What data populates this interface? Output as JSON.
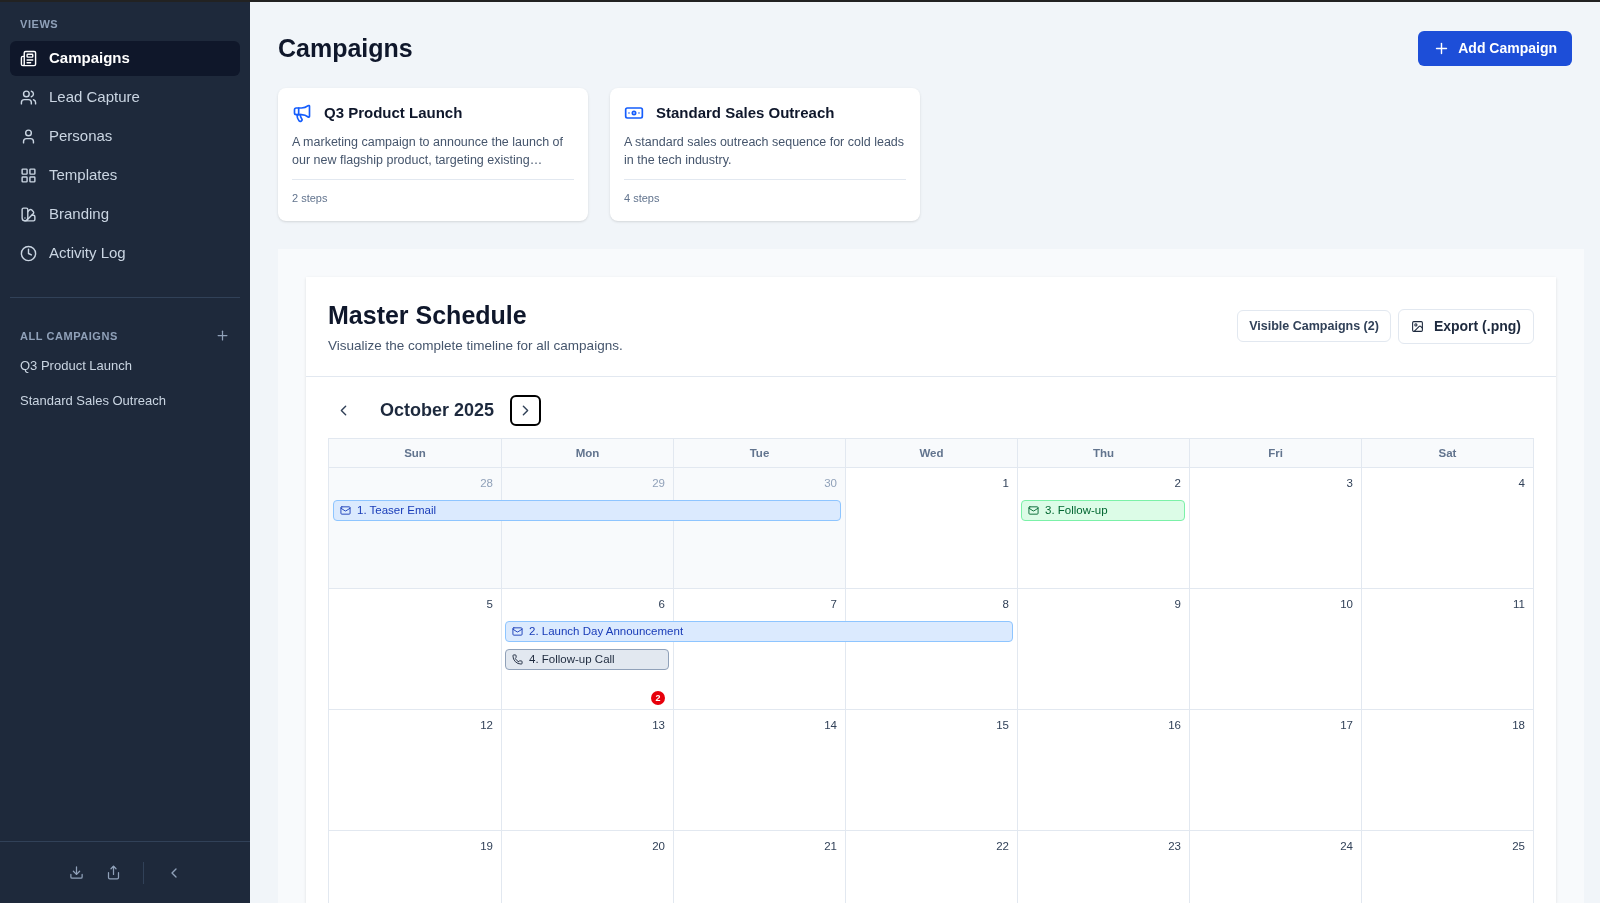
{
  "sidebar": {
    "views_heading": "VIEWS",
    "items": [
      {
        "label": "Campaigns",
        "selected": true
      },
      {
        "label": "Lead Capture",
        "selected": false
      },
      {
        "label": "Personas",
        "selected": false
      },
      {
        "label": "Templates",
        "selected": false
      },
      {
        "label": "Branding",
        "selected": false
      },
      {
        "label": "Activity Log",
        "selected": false
      }
    ],
    "campaigns_heading": "ALL CAMPAIGNS",
    "campaigns": [
      "Q3 Product Launch",
      "Standard Sales Outreach"
    ]
  },
  "header": {
    "title": "Campaigns",
    "add_button": "Add Campaign"
  },
  "cards": [
    {
      "title": "Q3 Product Launch",
      "description": "A marketing campaign to announce the launch of our new flagship product, targeting existing…",
      "steps": "2 steps"
    },
    {
      "title": "Standard Sales Outreach",
      "description": "A standard sales outreach sequence for cold leads in the tech industry.",
      "steps": "4 steps"
    }
  ],
  "schedule": {
    "title": "Master Schedule",
    "subtitle": "Visualize the complete timeline for all campaigns.",
    "visible_button": "Visible Campaigns (2)",
    "export_button": "Export (.png)",
    "month": "October 2025",
    "weekdays": [
      "Sun",
      "Mon",
      "Tue",
      "Wed",
      "Thu",
      "Fri",
      "Sat"
    ],
    "weeks": [
      {
        "days": [
          {
            "number": "28",
            "muted": true
          },
          {
            "number": "29",
            "muted": true
          },
          {
            "number": "30",
            "muted": true
          },
          {
            "number": "1",
            "muted": false
          },
          {
            "number": "2",
            "muted": false
          },
          {
            "number": "3",
            "muted": false
          },
          {
            "number": "4",
            "muted": false
          }
        ],
        "events": [
          {
            "label": "1. Teaser Email",
            "kind": "email",
            "color": "#dbeafe"
          },
          {
            "label": "3. Follow-up",
            "kind": "email",
            "color": "#dcfce7"
          }
        ]
      },
      {
        "days": [
          {
            "number": "5",
            "muted": false
          },
          {
            "number": "6",
            "muted": false,
            "badge": "2"
          },
          {
            "number": "7",
            "muted": false
          },
          {
            "number": "8",
            "muted": false
          },
          {
            "number": "9",
            "muted": false
          },
          {
            "number": "10",
            "muted": false
          },
          {
            "number": "11",
            "muted": false
          }
        ],
        "events": [
          {
            "label": "2. Launch Day Announcement",
            "kind": "email",
            "color": "#dbeafe"
          },
          {
            "label": "4. Follow-up Call",
            "kind": "call",
            "color": "#e2e8f0"
          }
        ]
      },
      {
        "days": [
          {
            "number": "12",
            "muted": false
          },
          {
            "number": "13",
            "muted": false
          },
          {
            "number": "14",
            "muted": false
          },
          {
            "number": "15",
            "muted": false
          },
          {
            "number": "16",
            "muted": false
          },
          {
            "number": "17",
            "muted": false
          },
          {
            "number": "18",
            "muted": false
          }
        ]
      },
      {
        "days": [
          {
            "number": "19",
            "muted": false
          },
          {
            "number": "20",
            "muted": false
          },
          {
            "number": "21",
            "muted": false
          },
          {
            "number": "22",
            "muted": false
          },
          {
            "number": "23",
            "muted": false
          },
          {
            "number": "24",
            "muted": false
          },
          {
            "number": "25",
            "muted": false
          }
        ]
      }
    ]
  }
}
